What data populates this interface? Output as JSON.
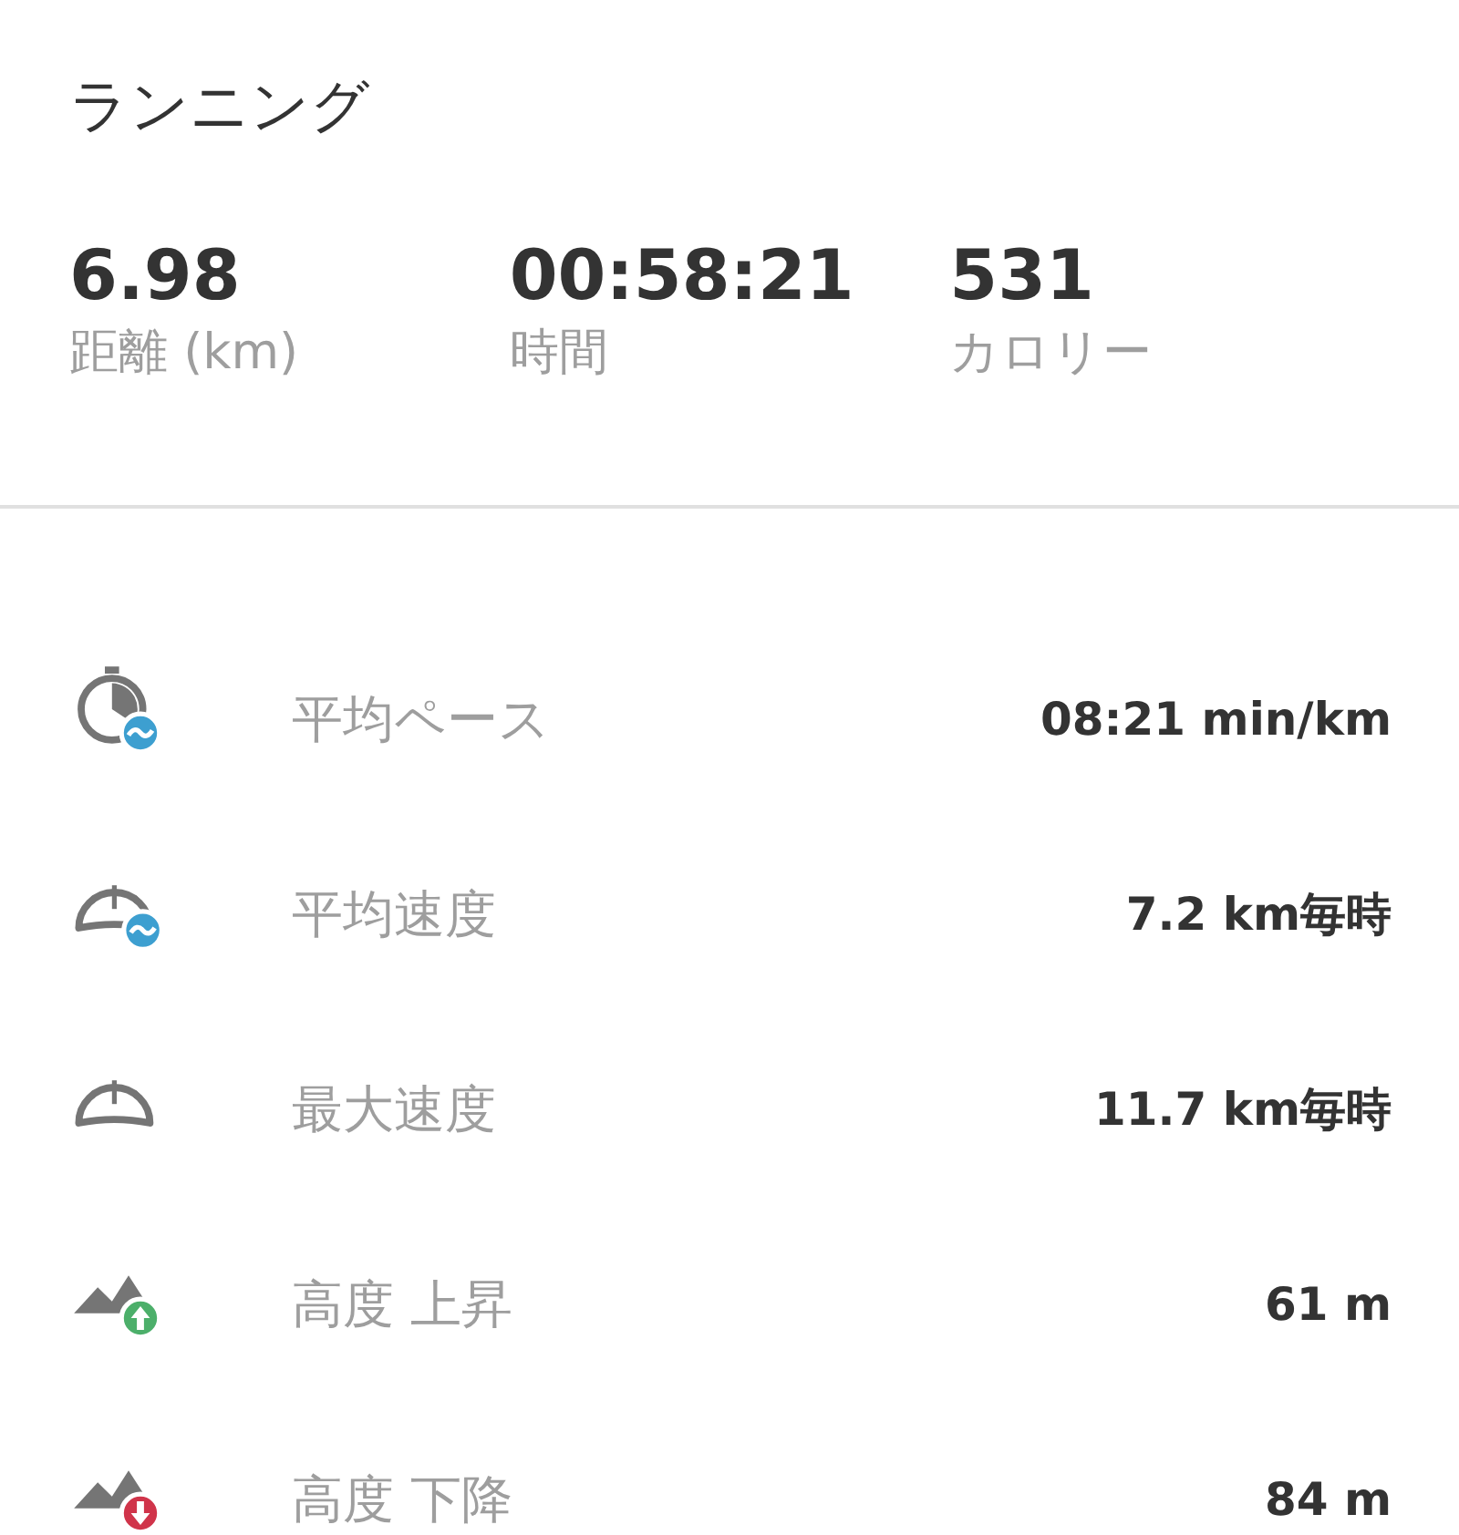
{
  "title": "ランニング",
  "summary": [
    {
      "value": "6.98",
      "label": "距離 (km)"
    },
    {
      "value": "00:58:21",
      "label": "時間"
    },
    {
      "value": "531",
      "label": "カロリー"
    }
  ],
  "details": [
    {
      "kind": "avg-pace",
      "label": "平均ペース",
      "value": "08:21 min/km"
    },
    {
      "kind": "avg-speed",
      "label": "平均速度",
      "value": "7.2 km毎時"
    },
    {
      "kind": "max-speed",
      "label": "最大速度",
      "value": "11.7 km毎時"
    },
    {
      "kind": "ascent",
      "label": "高度 上昇",
      "value": "61 m"
    },
    {
      "kind": "descent",
      "label": "高度 下降",
      "value": "84 m"
    }
  ]
}
